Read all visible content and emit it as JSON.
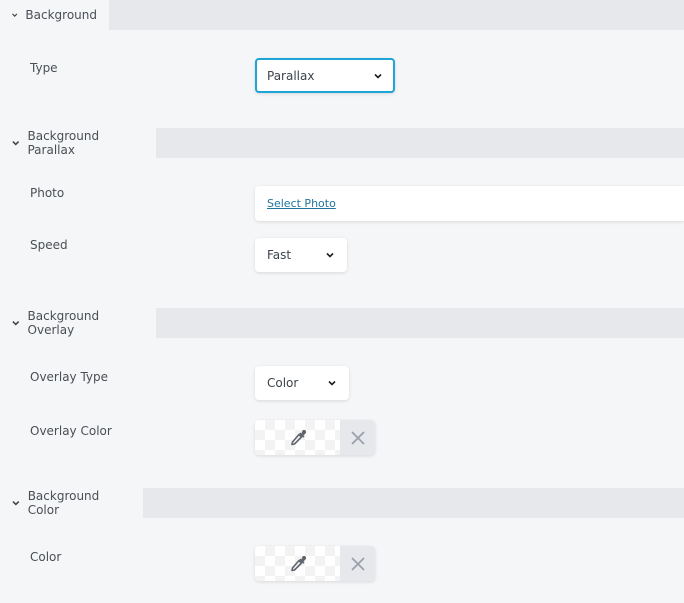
{
  "sections": [
    {
      "title": "Background",
      "fields": [
        {
          "label": "Type",
          "control": "select",
          "value": "Parallax",
          "focused": true
        }
      ]
    },
    {
      "title": "Background Parallax",
      "fields": [
        {
          "label": "Photo",
          "control": "photo",
          "link_text": "Select Photo"
        },
        {
          "label": "Speed",
          "control": "select",
          "value": "Fast"
        }
      ]
    },
    {
      "title": "Background Overlay",
      "fields": [
        {
          "label": "Overlay Type",
          "control": "select",
          "value": "Color"
        },
        {
          "label": "Overlay Color",
          "control": "color",
          "picker_icon": "eyedropper-icon",
          "clear_icon": "close-icon"
        }
      ]
    },
    {
      "title": "Background Color",
      "fields": [
        {
          "label": "Color",
          "control": "color",
          "picker_icon": "eyedropper-icon",
          "clear_icon": "close-icon"
        }
      ]
    }
  ],
  "colors": {
    "focus_border": "#1ca5d6",
    "link": "#21759b",
    "header_bg": "#e6e8ec",
    "panel_bg": "#f5f6f8"
  }
}
